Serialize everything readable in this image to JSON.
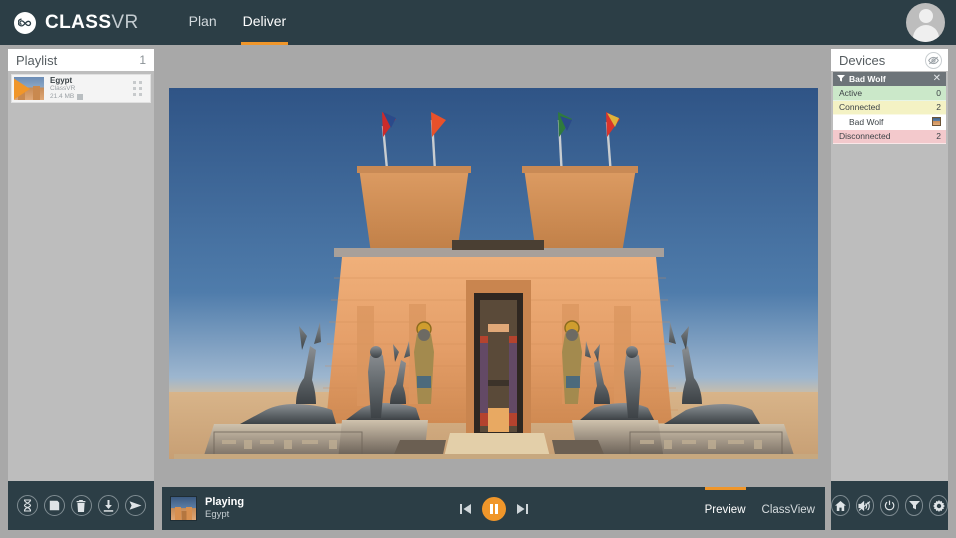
{
  "header": {
    "logo_mark": "infinity-icon",
    "logo_bold": "CLASS",
    "logo_light": "VR",
    "nav": [
      {
        "label": "Plan",
        "active": false
      },
      {
        "label": "Deliver",
        "active": true
      }
    ],
    "avatar": "user-avatar",
    "bg_color": "#2c3e46",
    "accent_color": "#f0962a"
  },
  "playlist": {
    "title": "Playlist",
    "count": "1",
    "items": [
      {
        "name": "Egypt",
        "source": "ClassVR",
        "size": "21.4 MB",
        "thumb": "egypt-temple-thumbnail",
        "play_overlay": "play-icon",
        "handle": "drag-handle-icon"
      }
    ],
    "toolbar": [
      {
        "name": "timer-icon",
        "label": "Timer"
      },
      {
        "name": "save-icon",
        "label": "Save"
      },
      {
        "name": "delete-icon",
        "label": "Delete"
      },
      {
        "name": "download-icon",
        "label": "Download"
      },
      {
        "name": "send-icon",
        "label": "Send"
      }
    ]
  },
  "viewer": {
    "scene_name": "Egypt Temple 360 Scene",
    "sky_top": "#2f5486",
    "sky_bottom": "#9db6cf",
    "sand_color": "#d9b48c",
    "stone_color": "#e0a06a",
    "flags": [
      {
        "color": "#cc2b2b"
      },
      {
        "color": "#e8512a"
      },
      {
        "color": "#2f7a3e"
      },
      {
        "color": "#d9342b"
      }
    ]
  },
  "player": {
    "thumb": "egypt-temple-thumbnail",
    "status": "Playing",
    "title": "Egypt",
    "controls": [
      {
        "name": "previous-button",
        "glyph": "prev"
      },
      {
        "name": "pause-button",
        "glyph": "pause"
      },
      {
        "name": "next-button",
        "glyph": "next"
      }
    ],
    "tabs": [
      {
        "label": "Preview",
        "active": true
      },
      {
        "label": "ClassView",
        "active": false
      }
    ]
  },
  "devices": {
    "title": "Devices",
    "hide_icon": "eye-off-icon",
    "group": {
      "filter_icon": "funnel-icon",
      "name": "Bad Wolf",
      "close_icon": "close-icon"
    },
    "rows": [
      {
        "label": "Active",
        "value": "0",
        "state": "active",
        "thumb": false
      },
      {
        "label": "Connected",
        "value": "2",
        "state": "connected",
        "thumb": false
      },
      {
        "label": "Bad Wolf",
        "value": "",
        "state": "child",
        "thumb": true
      },
      {
        "label": "Disconnected",
        "value": "2",
        "state": "disconnected",
        "thumb": false
      }
    ],
    "colors": {
      "active": "#cbe8c9",
      "connected": "#f4f2c4",
      "child": "#ffffff",
      "disconnected": "#f3c9cc"
    },
    "toolbar": [
      {
        "name": "home-icon",
        "label": "Home"
      },
      {
        "name": "mute-icon",
        "label": "Mute"
      },
      {
        "name": "power-icon",
        "label": "Power"
      },
      {
        "name": "filter-icon",
        "label": "Filter"
      },
      {
        "name": "settings-icon",
        "label": "Settings"
      }
    ]
  }
}
